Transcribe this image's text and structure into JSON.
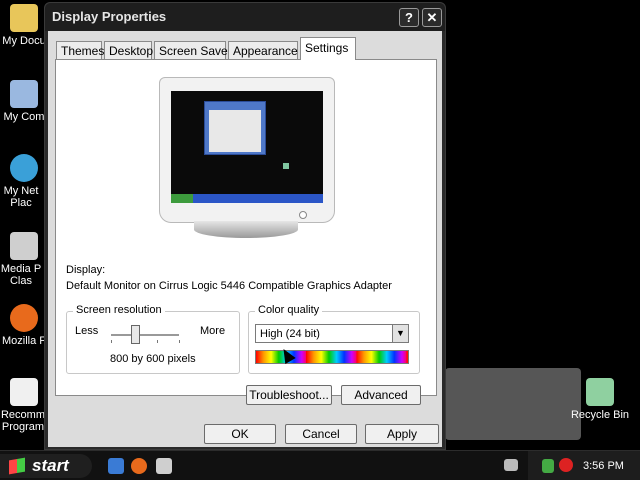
{
  "desktop": {
    "icons": [
      {
        "label": "My Docu",
        "icon": "folder-icon"
      },
      {
        "label": "My Com",
        "icon": "computer-icon"
      },
      {
        "label": "My Net Plac",
        "icon": "network-icon"
      },
      {
        "label": "Media P Clas",
        "icon": "media-player-icon"
      },
      {
        "label": "Mozilla F",
        "icon": "firefox-icon"
      },
      {
        "label": "Recomm Program",
        "icon": "document-icon"
      },
      {
        "label": "Recycle Bin",
        "icon": "recycle-bin-icon"
      }
    ]
  },
  "window": {
    "title": "Display Properties",
    "help_symbol": "?",
    "close_symbol": "✕",
    "tabs": [
      "Themes",
      "Desktop",
      "Screen Saver",
      "Appearance",
      "Settings"
    ],
    "active_tab": "Settings",
    "display_label": "Display:",
    "display_value": "Default Monitor on Cirrus Logic 5446 Compatible Graphics Adapter",
    "resolution": {
      "title": "Screen resolution",
      "less": "Less",
      "more": "More",
      "value_text": "800 by 600 pixels"
    },
    "color": {
      "title": "Color quality",
      "selected": "High (24 bit)"
    },
    "buttons": {
      "troubleshoot": "Troubleshoot...",
      "advanced": "Advanced",
      "ok": "OK",
      "cancel": "Cancel",
      "apply": "Apply"
    }
  },
  "taskbar": {
    "start_label": "start",
    "clock": "3:56 PM"
  },
  "colors": {
    "taskbar_bg": "#111111",
    "window_frame": "#2a2a2a",
    "client_bg": "#dcdcdc",
    "panel_bg": "#ffffff"
  }
}
